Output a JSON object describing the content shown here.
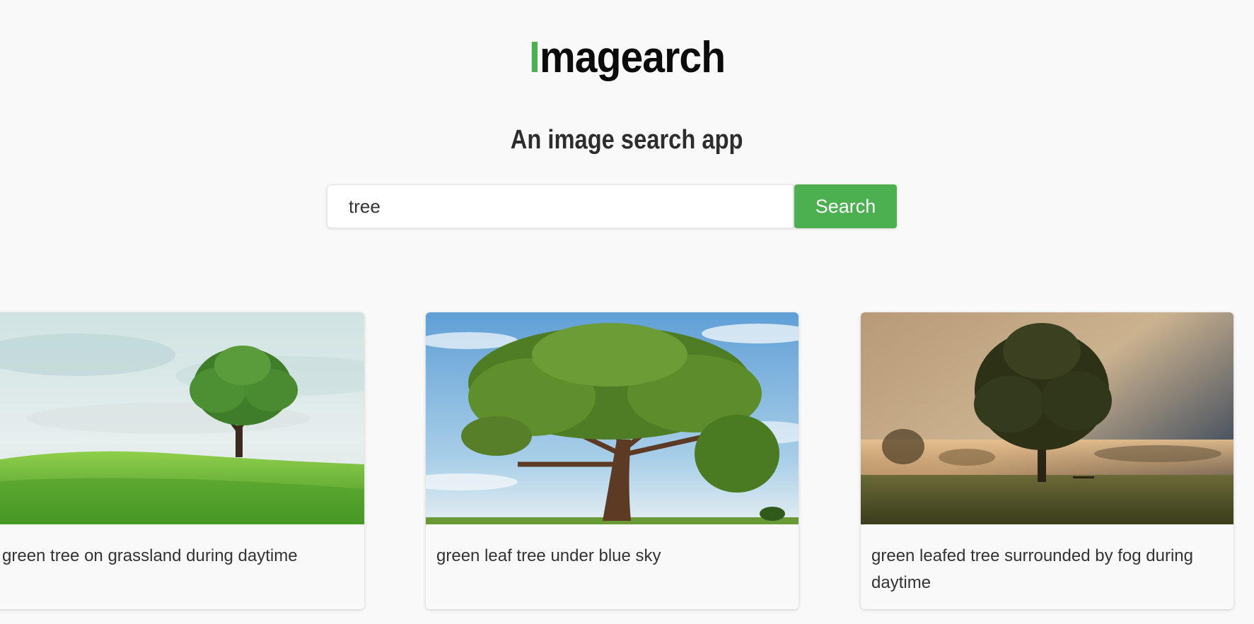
{
  "app": {
    "logo_first_letter": "I",
    "logo_rest": "magearch",
    "tagline": "An image search app",
    "accent_color": "#4caf50"
  },
  "search": {
    "value": "tree",
    "button_label": "Search"
  },
  "results": [
    {
      "caption": "green tree on grassland during daytime"
    },
    {
      "caption": "green leaf tree under blue sky"
    },
    {
      "caption": "green leafed tree surrounded by fog during daytime"
    }
  ]
}
